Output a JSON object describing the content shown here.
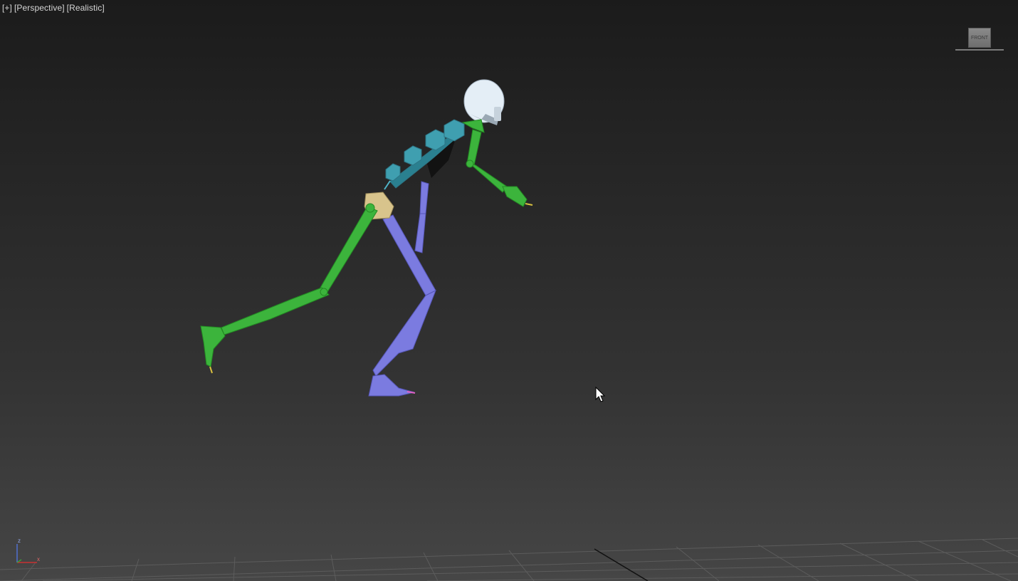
{
  "viewport": {
    "menu_label": "[+]",
    "view_label": "[Perspective]",
    "shading_label": "[Realistic]"
  },
  "viewcube": {
    "face_label": "FRONT"
  },
  "axis_tripod": {
    "z_label": "z",
    "x_label": "x"
  },
  "colors": {
    "background_top": "#1b1b1b",
    "background_bottom": "#464646",
    "left_limbs": "#3cb43c",
    "right_limbs": "#7b7be0",
    "spine": "#3f9fb0",
    "head": "#e4eef6",
    "pelvis": "#d8c48c",
    "grid": "#5a5a5a"
  },
  "icons": [
    "viewcube-icon",
    "mouse-cursor-icon",
    "axis-tripod-icon"
  ]
}
